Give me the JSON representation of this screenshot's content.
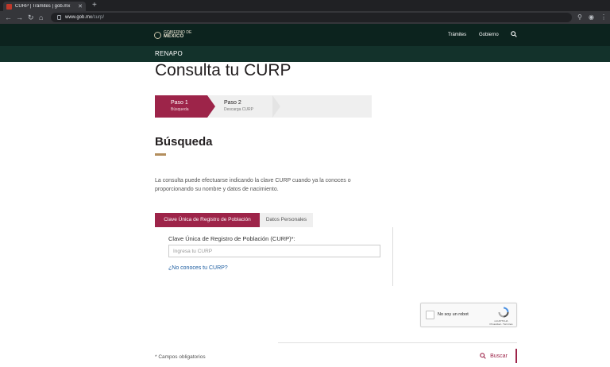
{
  "browser": {
    "tab_title": "CURP | Trámites | gob.mx",
    "url_host": "www.gob.mx",
    "url_path": "/curp/"
  },
  "header": {
    "logo_top": "GOBIERNO DE",
    "logo_main": "MÉXICO",
    "links": [
      "Trámites",
      "Gobierno"
    ],
    "section": "RENAPO"
  },
  "page": {
    "title": "Consulta tu CURP"
  },
  "stepper": {
    "steps": [
      {
        "label": "Paso 1",
        "sub": "Búsqueda"
      },
      {
        "label": "Paso 2",
        "sub": "Descarga CURP"
      }
    ]
  },
  "search": {
    "title": "Búsqueda",
    "description": "La consulta puede efectuarse indicando la clave CURP cuando ya la conoces o proporcionando su nombre y datos de nacimiento.",
    "tabs": [
      "Clave Única de Registro de Población",
      "Datos Personales"
    ],
    "field_label": "Clave Única de Registro de Población (CURP)*:",
    "field_placeholder": "Ingresa tu CURP",
    "field_value": "",
    "forgot_link": "¿No conoces tu CURP?"
  },
  "captcha": {
    "label": "No soy un robot",
    "brand": "reCAPTCHA",
    "terms": "Privacidad - Términos"
  },
  "footer": {
    "required_note": "* Campos obligatorios",
    "search_button": "Buscar"
  },
  "colors": {
    "header_bg": "#0c231e",
    "renapo_bg": "#13322b",
    "accent": "#9d2449",
    "underline": "#b38e5d"
  }
}
